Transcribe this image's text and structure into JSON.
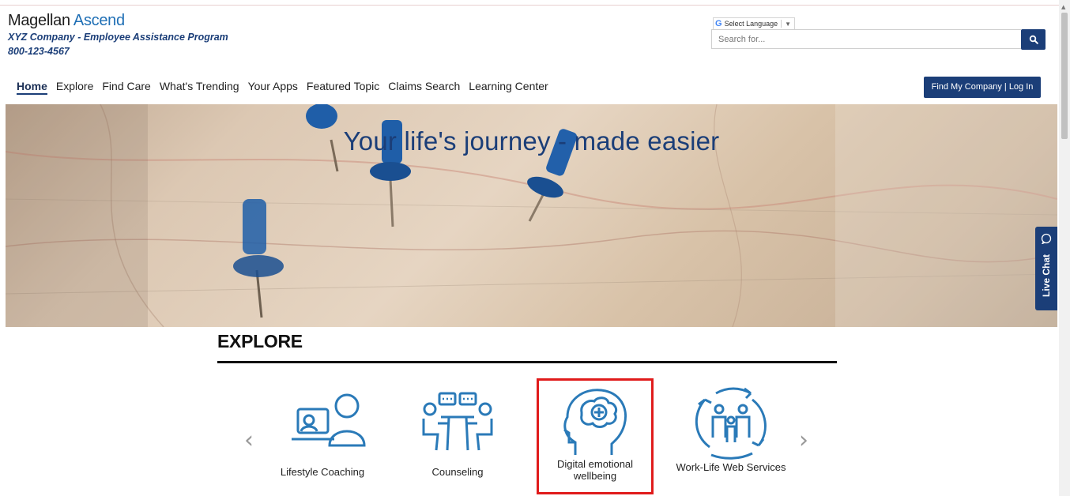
{
  "header": {
    "logo_part1": "Magellan",
    "logo_part2": "Ascend",
    "program": "XYZ Company - Employee Assistance Program",
    "phone": "800-123-4567"
  },
  "language": {
    "label": "Select Language",
    "arrow": "▼"
  },
  "search": {
    "placeholder": "Search for..."
  },
  "nav": {
    "items": [
      "Home",
      "Explore",
      "Find Care",
      "What's Trending",
      "Your Apps",
      "Featured Topic",
      "Claims Search",
      "Learning Center"
    ],
    "active_index": 0
  },
  "login_button": "Find My Company | Log In",
  "hero": {
    "title": "Your life's journey - made easier"
  },
  "live_chat": {
    "label": "Live Chat"
  },
  "explore": {
    "heading": "EXPLORE",
    "cards": [
      {
        "label": "Lifestyle Coaching",
        "icon": "person-laptop-icon"
      },
      {
        "label": "Counseling",
        "icon": "counseling-table-icon"
      },
      {
        "label": "Digital emotional wellbeing",
        "icon": "head-plus-icon",
        "selected": true
      },
      {
        "label": "Work-Life Web Services",
        "icon": "family-cycle-icon"
      }
    ],
    "prev": "‹",
    "next": "›"
  },
  "colors": {
    "primary": "#1b3e78",
    "accent_blue": "#1f6fb5",
    "icon_blue": "#2a7ab8",
    "highlight": "#e01b1b"
  }
}
